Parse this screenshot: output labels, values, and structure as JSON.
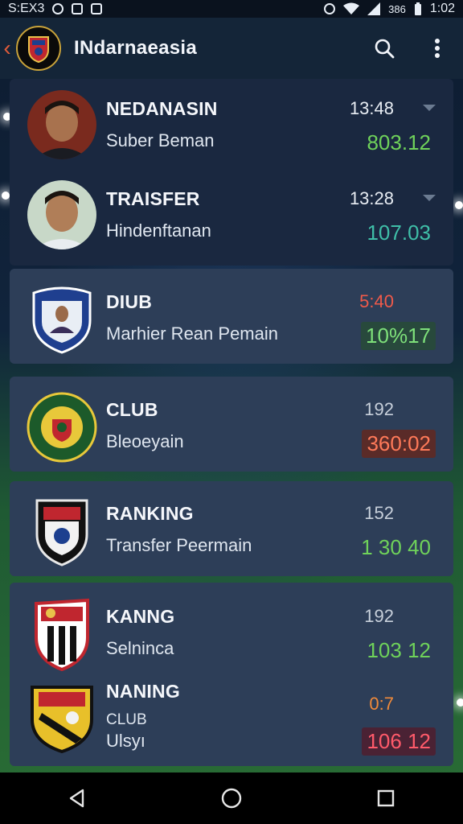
{
  "status_bar": {
    "left_text": "S:EX3",
    "signal_text": "386",
    "clock": "1:02"
  },
  "app_bar": {
    "title": "INdarnaeasia"
  },
  "rows": [
    {
      "title": "NEDANASIN",
      "subtitle": "Suber Beman",
      "time": "13:48",
      "value": "803.12",
      "icon": "player-avatar"
    },
    {
      "title": "TRAISFER",
      "subtitle": "Hindenftanan",
      "time": "13:28",
      "value": "107.03",
      "icon": "player-avatar"
    },
    {
      "title": "DIUB",
      "subtitle": "Marhier Rean Pemain",
      "time": "5:40",
      "value": "10%17",
      "icon": "club-shield"
    },
    {
      "title": "CLUB",
      "subtitle": "Bleoeyain",
      "time": "192",
      "value": "360:02",
      "icon": "club-round-badge"
    },
    {
      "title": "RANKING",
      "subtitle": "Transfer Peermain",
      "time": "152",
      "value": "1 30 40",
      "icon": "club-shield"
    },
    {
      "title": "KANNG",
      "subtitle": "Selninca",
      "time": "192",
      "value": "103 12",
      "icon": "club-shield"
    },
    {
      "title": "NANING",
      "subtitle2": "CLUB",
      "subtitle": "Ulsyı",
      "time": "0:7",
      "value": "106 12",
      "icon": "club-shield"
    }
  ],
  "colors": {
    "accent_green": "#6fd25a",
    "accent_red": "#f05a4a",
    "card_dark": "#1a2840",
    "card_light": "#2d3e58"
  }
}
